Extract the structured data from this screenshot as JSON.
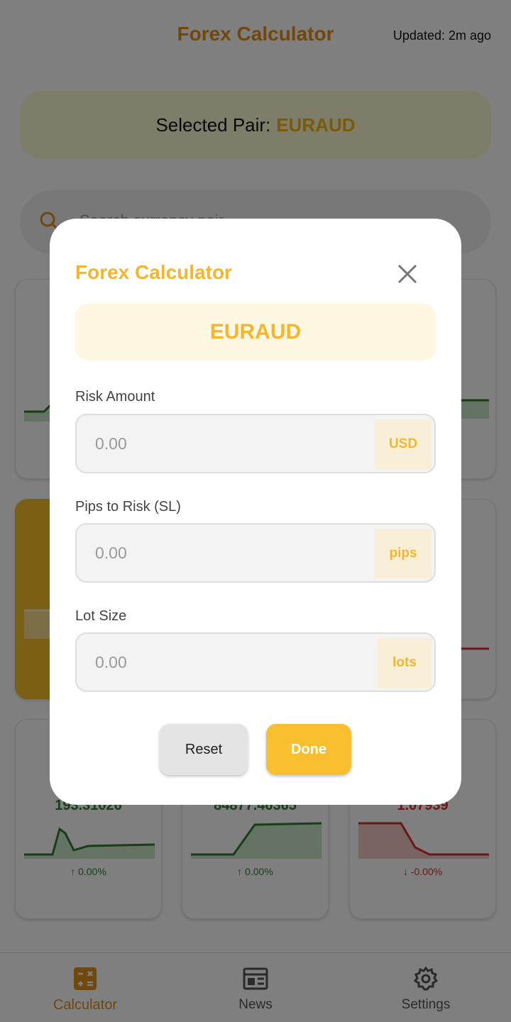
{
  "header": {
    "title": "Forex Calculator",
    "updated": "Updated: 2m ago"
  },
  "selected": {
    "prefix": "Selected Pair:",
    "pair": "EURAUD"
  },
  "search": {
    "placeholder": "Search currency pair..."
  },
  "cards": [
    {
      "price": "193.31026",
      "change": "0.00%",
      "direction": "up"
    },
    {
      "price": "84877.46365",
      "change": "0.00%",
      "direction": "up"
    },
    {
      "price": "1.07939",
      "change": "-0.00%",
      "direction": "down"
    }
  ],
  "dialog": {
    "title": "Forex Calculator",
    "pair": "EURAUD",
    "fields": [
      {
        "label": "Risk Amount",
        "placeholder": "0.00",
        "unit": "USD"
      },
      {
        "label": "Pips to Risk (SL)",
        "placeholder": "0.00",
        "unit": "pips"
      },
      {
        "label": "Lot Size",
        "placeholder": "0.00",
        "unit": "lots"
      }
    ],
    "reset_label": "Reset",
    "done_label": "Done"
  },
  "nav": {
    "items": [
      {
        "label": "Calculator",
        "icon": "calculator-icon",
        "active": true
      },
      {
        "label": "News",
        "icon": "news-icon",
        "active": false
      },
      {
        "label": "Settings",
        "icon": "gear-icon",
        "active": false
      }
    ]
  },
  "colors": {
    "accent": "#f2b630",
    "title": "#e0901a",
    "up": "#2e7d32",
    "down": "#d32f2f"
  }
}
